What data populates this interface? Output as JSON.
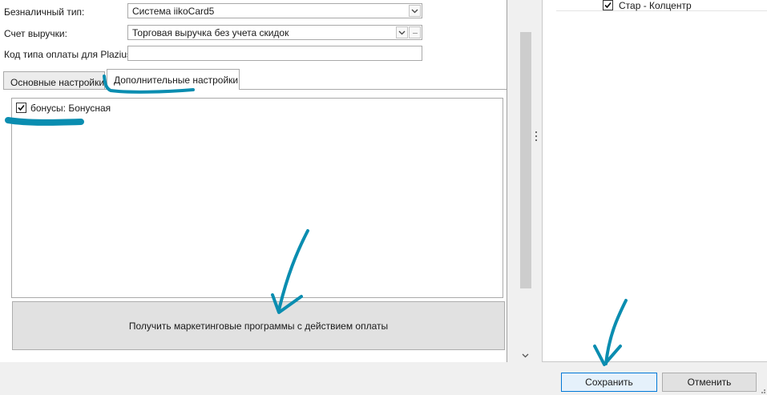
{
  "form": {
    "payment_type_label": "Безналичный тип:",
    "payment_type_value": "Система iikoCard5",
    "revenue_account_label": "Счет выручки:",
    "revenue_account_value": "Торговая выручка без учета скидок",
    "ellipsis": "···",
    "plazius_code_label": "Код типа оплаты для Plazius:",
    "plazius_code_value": ""
  },
  "tabs": [
    {
      "label": "Основные настройки",
      "active": false
    },
    {
      "label": "Дополнительные настройки",
      "active": true
    }
  ],
  "programs_list": [
    {
      "label": "бонусы: Бонусная",
      "checked": true
    }
  ],
  "marketing_button_label": "Получить маркетинговые программы с действием оплаты",
  "right_panel": {
    "items": [
      {
        "label": "Стар - Колцентр",
        "checked": true
      }
    ]
  },
  "buttons": {
    "save": "Сохранить",
    "cancel": "Отменить"
  },
  "colors": {
    "annotation": "#0a8db0",
    "save_border": "#0078d7"
  },
  "icons": [
    "checkmark-icon",
    "chevron-down-icon",
    "scroll-down-icon",
    "ellipsis-icon"
  ]
}
